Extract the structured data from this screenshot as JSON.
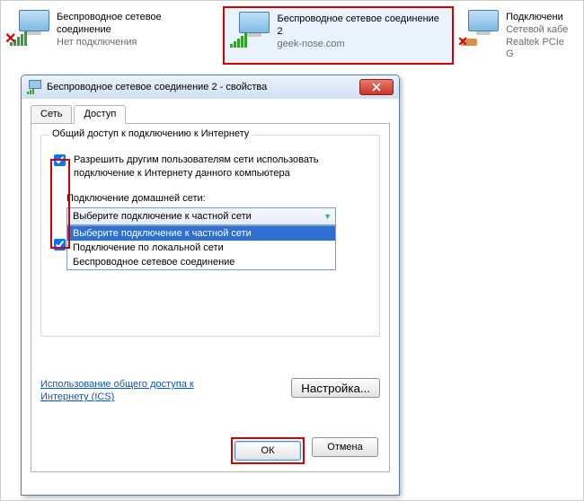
{
  "connections": [
    {
      "title": "Беспроводное сетевое соединение",
      "sub": "Нет подключения",
      "disconnected": true
    },
    {
      "title": "Беспроводное сетевое соединение 2",
      "sub": "geek-nose.com",
      "disconnected": false
    },
    {
      "title": "Подключени",
      "sub1": "Сетевой кабе",
      "sub2": "Realtek PCIe G"
    }
  ],
  "dialog": {
    "title": "Беспроводное сетевое соединение 2 - свойства",
    "tabs": {
      "network": "Сеть",
      "sharing": "Доступ"
    },
    "group_legend": "Общий доступ к подключению к Интернету",
    "chk1": "Разрешить другим пользователям сети использовать подключение к Интернету данного компьютера",
    "home_label": "Подключение домашней сети:",
    "select_value": "Выберите подключение к частной сети",
    "options": [
      "Выберите подключение к частной сети",
      "Подключение по локальной сети",
      "Беспроводное сетевое соединение"
    ],
    "link": "Использование общего доступа к Интернету (ICS)",
    "settings_btn": "Настройка...",
    "ok": "ОК",
    "cancel": "Отмена"
  }
}
